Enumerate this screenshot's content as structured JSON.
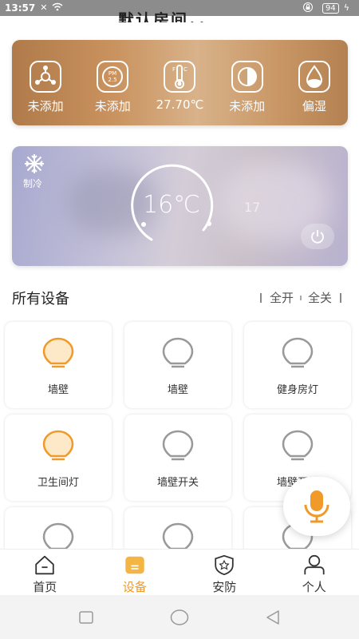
{
  "status_bar": {
    "time": "13:57",
    "battery": "94"
  },
  "header": {
    "room_title": "默认房间，，"
  },
  "environment": [
    {
      "icon": "air-purifier-icon",
      "label": "未添加"
    },
    {
      "icon": "pm25-icon",
      "label": "未添加"
    },
    {
      "icon": "thermometer-icon",
      "label": "27.70℃"
    },
    {
      "icon": "half-circle-icon",
      "label": "未添加"
    },
    {
      "icon": "humidity-drop-icon",
      "label": "偏湿"
    }
  ],
  "ac": {
    "mode_label": "制冷",
    "temperature": "16℃",
    "next_temperature": "17"
  },
  "devices_section": {
    "title": "所有设备",
    "all_on": "全开",
    "all_off": "全关"
  },
  "devices": [
    {
      "label": "墙壁",
      "on": true
    },
    {
      "label": "墙壁",
      "on": false
    },
    {
      "label": "健身房灯",
      "on": false
    },
    {
      "label": "卫生间灯",
      "on": true
    },
    {
      "label": "墙壁开关",
      "on": false
    },
    {
      "label": "墙壁开关",
      "on": false
    },
    {
      "label": "",
      "on": false
    },
    {
      "label": "",
      "on": false
    },
    {
      "label": "",
      "on": false
    }
  ],
  "nav": [
    {
      "label": "首页",
      "icon": "home-icon",
      "active": false
    },
    {
      "label": "设备",
      "icon": "device-icon",
      "active": true
    },
    {
      "label": "安防",
      "icon": "shield-icon",
      "active": false
    },
    {
      "label": "个人",
      "icon": "person-icon",
      "active": false
    }
  ],
  "colors": {
    "accent": "#f09a2a",
    "bulb_off": "#999999"
  }
}
